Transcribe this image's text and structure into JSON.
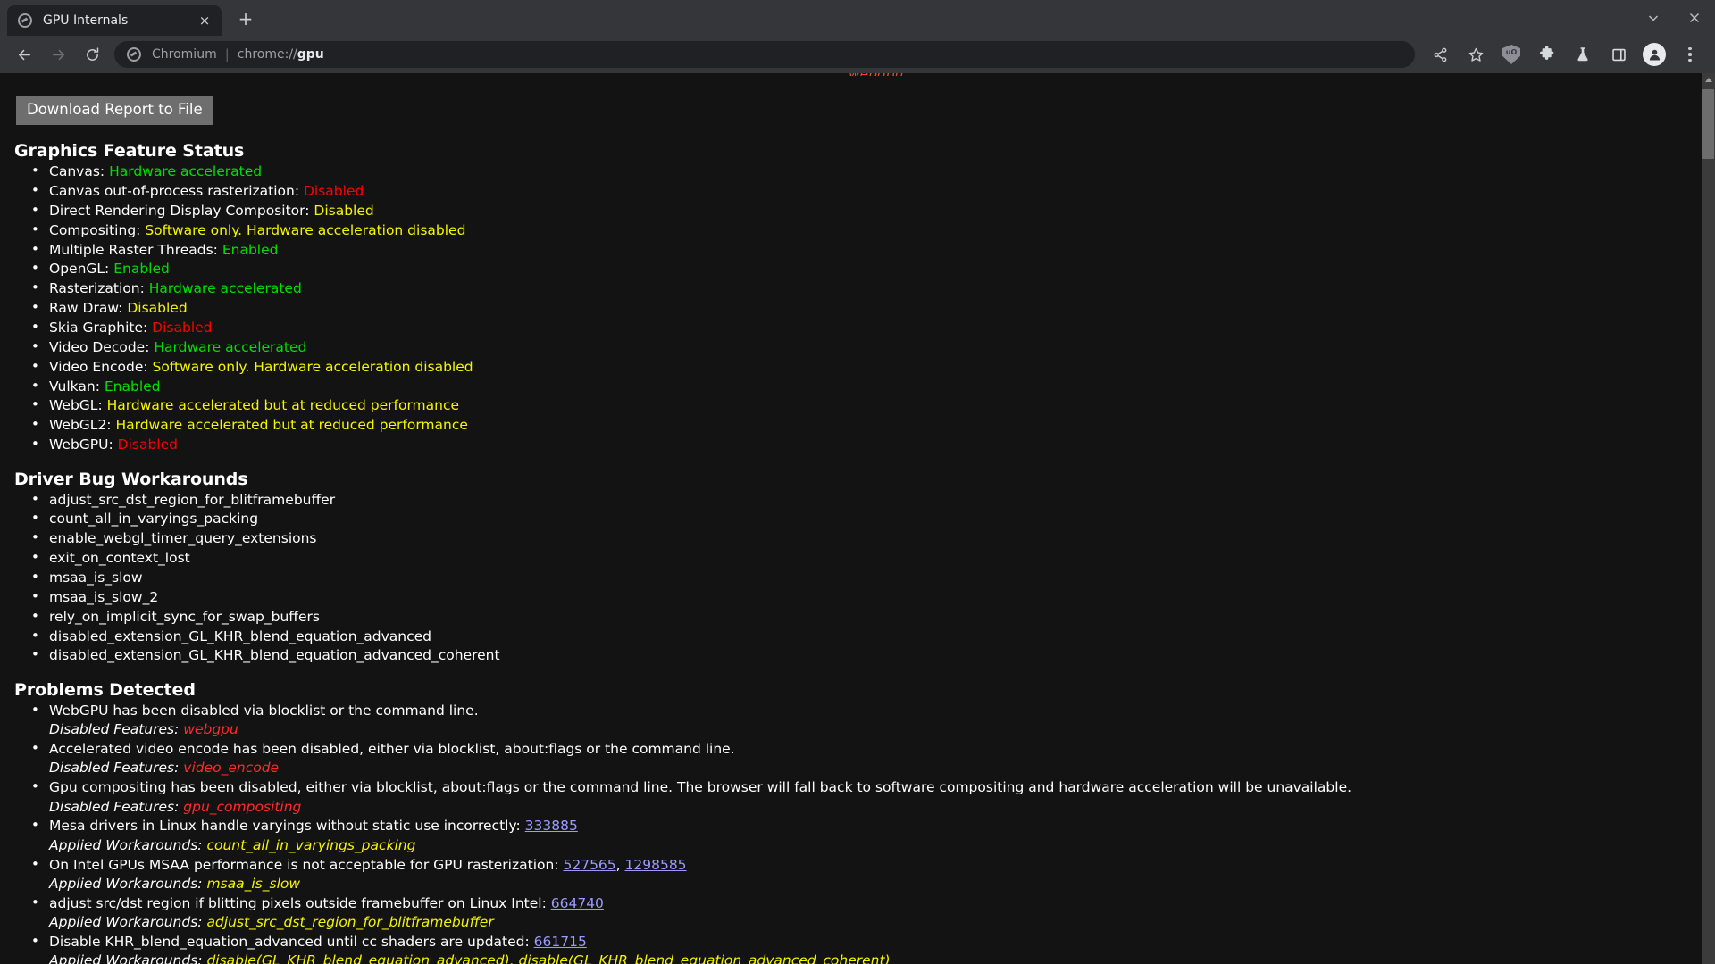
{
  "window": {
    "minimize_icon": "chevron-down-icon",
    "close_icon": "close-icon"
  },
  "tabstrip": {
    "tab_title": "GPU Internals",
    "tab_close_glyph": "×",
    "new_tab_glyph": "+",
    "favicon": "chromium-icon"
  },
  "toolbar": {
    "back_glyph": "←",
    "forward_glyph": "→",
    "reload_glyph": "⟳",
    "omnibox": {
      "brand": "Chromium",
      "separator": "|",
      "url_prefix": "chrome://",
      "url_bold": "gpu",
      "icon": "chromium-icon"
    },
    "actions": [
      {
        "name": "share-icon",
        "label": "Share"
      },
      {
        "name": "bookmark-star-icon",
        "label": "Bookmark this tab"
      },
      {
        "name": "ublock-shield-icon",
        "label": "uBlock Origin",
        "badge": "uO"
      },
      {
        "name": "extensions-puzzle-icon",
        "label": "Extensions"
      },
      {
        "name": "experiments-flask-icon",
        "label": "Experiments"
      },
      {
        "name": "side-panel-icon",
        "label": "Side panel"
      },
      {
        "name": "profile-avatar-icon",
        "label": "Profile"
      },
      {
        "name": "chrome-menu-icon",
        "label": "Customize and control Chromium"
      }
    ]
  },
  "page": {
    "clipped_top_text": "webgpu",
    "download_button": "Download Report to File",
    "sections": [
      {
        "heading": "Graphics Feature Status",
        "items": [
          {
            "label": "Canvas:",
            "value": "Hardware accelerated",
            "status": "green"
          },
          {
            "label": "Canvas out-of-process rasterization:",
            "value": "Disabled",
            "status": "red"
          },
          {
            "label": "Direct Rendering Display Compositor:",
            "value": "Disabled",
            "status": "yellow"
          },
          {
            "label": "Compositing:",
            "value": "Software only. Hardware acceleration disabled",
            "status": "yellow"
          },
          {
            "label": "Multiple Raster Threads:",
            "value": "Enabled",
            "status": "green"
          },
          {
            "label": "OpenGL:",
            "value": "Enabled",
            "status": "green"
          },
          {
            "label": "Rasterization:",
            "value": "Hardware accelerated",
            "status": "green"
          },
          {
            "label": "Raw Draw:",
            "value": "Disabled",
            "status": "yellow"
          },
          {
            "label": "Skia Graphite:",
            "value": "Disabled",
            "status": "red"
          },
          {
            "label": "Video Decode:",
            "value": "Hardware accelerated",
            "status": "green"
          },
          {
            "label": "Video Encode:",
            "value": "Software only. Hardware acceleration disabled",
            "status": "yellow"
          },
          {
            "label": "Vulkan:",
            "value": "Enabled",
            "status": "green"
          },
          {
            "label": "WebGL:",
            "value": "Hardware accelerated but at reduced performance",
            "status": "yellow"
          },
          {
            "label": "WebGL2:",
            "value": "Hardware accelerated but at reduced performance",
            "status": "yellow"
          },
          {
            "label": "WebGPU:",
            "value": "Disabled",
            "status": "red"
          }
        ]
      },
      {
        "heading": "Driver Bug Workarounds",
        "items": [
          {
            "label": "adjust_src_dst_region_for_blitframebuffer"
          },
          {
            "label": "count_all_in_varyings_packing"
          },
          {
            "label": "enable_webgl_timer_query_extensions"
          },
          {
            "label": "exit_on_context_lost"
          },
          {
            "label": "msaa_is_slow"
          },
          {
            "label": "msaa_is_slow_2"
          },
          {
            "label": "rely_on_implicit_sync_for_swap_buffers"
          },
          {
            "label": "disabled_extension_GL_KHR_blend_equation_advanced"
          },
          {
            "label": "disabled_extension_GL_KHR_blend_equation_advanced_coherent"
          }
        ]
      }
    ],
    "problems": {
      "heading": "Problems Detected",
      "disabled_features_label": "Disabled Features:",
      "applied_workarounds_label": "Applied Workarounds:",
      "entries": [
        {
          "description": "WebGPU has been disabled via blocklist or the command line.",
          "links": [],
          "sub_label": "Disabled Features:",
          "sub_value": "webgpu",
          "sub_color": "red"
        },
        {
          "description": "Accelerated video encode has been disabled, either via blocklist, about:flags or the command line.",
          "links": [],
          "sub_label": "Disabled Features:",
          "sub_value": "video_encode",
          "sub_color": "red"
        },
        {
          "description": "Gpu compositing has been disabled, either via blocklist, about:flags or the command line. The browser will fall back to software compositing and hardware acceleration will be unavailable.",
          "links": [],
          "sub_label": "Disabled Features:",
          "sub_value": "gpu_compositing",
          "sub_color": "red"
        },
        {
          "description": "Mesa drivers in Linux handle varyings without static use incorrectly:",
          "links": [
            "333885"
          ],
          "sub_label": "Applied Workarounds:",
          "sub_value": "count_all_in_varyings_packing",
          "sub_color": "yellow"
        },
        {
          "description": "On Intel GPUs MSAA performance is not acceptable for GPU rasterization:",
          "links": [
            "527565",
            "1298585"
          ],
          "sub_label": "Applied Workarounds:",
          "sub_value": "msaa_is_slow",
          "sub_color": "yellow"
        },
        {
          "description": "adjust src/dst region if blitting pixels outside framebuffer on Linux Intel:",
          "links": [
            "664740"
          ],
          "sub_label": "Applied Workarounds:",
          "sub_value": "adjust_src_dst_region_for_blitframebuffer",
          "sub_color": "yellow"
        },
        {
          "description": "Disable KHR_blend_equation_advanced until cc shaders are updated:",
          "links": [
            "661715"
          ],
          "sub_label": "Applied Workarounds:",
          "sub_value": "disable(GL_KHR_blend_equation_advanced), disable(GL_KHR_blend_equation_advanced_coherent)",
          "sub_color": "yellow"
        }
      ]
    }
  },
  "scrollbar": {
    "up_arrow": "scroll-up-arrow-icon"
  },
  "colors": {
    "green": "#00e000",
    "red": "#ff0000",
    "yellow": "#f5f500",
    "link": "#9b9bff",
    "page_bg": "#131313",
    "chrome_bg": "#35363a"
  }
}
